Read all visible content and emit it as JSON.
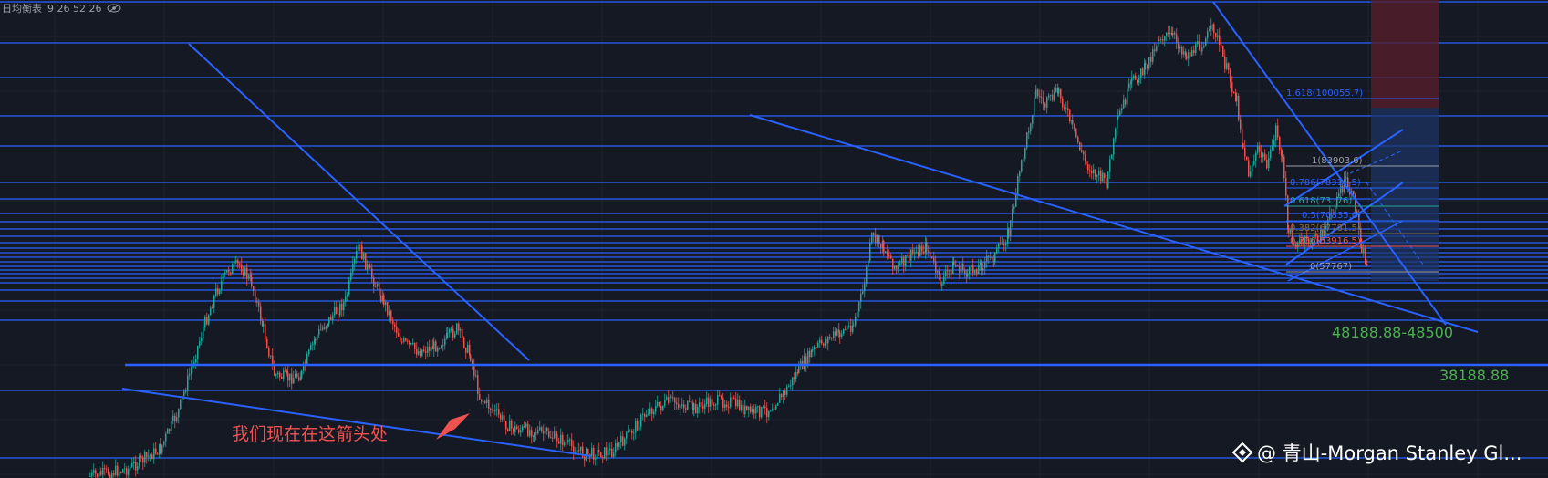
{
  "topbar": {
    "indicator_label": "日均衡表",
    "indicator_params": "9 26 52 26",
    "visibility_icon": "eye-slash-icon"
  },
  "colors": {
    "background": "#151924",
    "grid": "#1f2430",
    "line": "#2962ff",
    "up": "#26a69a",
    "down": "#ef5350",
    "level_text": "#4caf50",
    "fib_text": "#2962ff",
    "annotation": "#ef5350"
  },
  "annotation": {
    "text": "我们现在在这箭头处"
  },
  "price_labels": [
    {
      "text": "48188.88-48500"
    },
    {
      "text": "38188.88"
    }
  ],
  "fibonacci": [
    {
      "label": "1.618(100055.7)"
    },
    {
      "label": "1(83903.6)"
    },
    {
      "label": "0.786(78311.5)"
    },
    {
      "label": "0.618(73..76)"
    },
    {
      "label": "0.5(70835.6)"
    },
    {
      "label": "0.382(67781.5)"
    },
    {
      "label": "0.236(63916.5)"
    },
    {
      "label": "0(57767)"
    }
  ],
  "watermark": {
    "text": "@ 青山-Morgan Stanley Gl...",
    "logo": "binance-logo-icon"
  },
  "chart_data": {
    "type": "line",
    "description_of_series": "candlestick price history",
    "levels": [
      48188.88,
      38188.88
    ],
    "fib_levels": [
      {
        "ratio": 1.618,
        "price": 100055.7
      },
      {
        "ratio": 1,
        "price": 83903.6
      },
      {
        "ratio": 0.786,
        "price": 78311.5
      },
      {
        "ratio": 0.5,
        "price": 70835.6
      },
      {
        "ratio": 0.382,
        "price": 67781.5
      },
      {
        "ratio": 0.236,
        "price": 63916.5
      },
      {
        "ratio": 0,
        "price": 57767
      }
    ],
    "grid": true,
    "legend": "none"
  }
}
